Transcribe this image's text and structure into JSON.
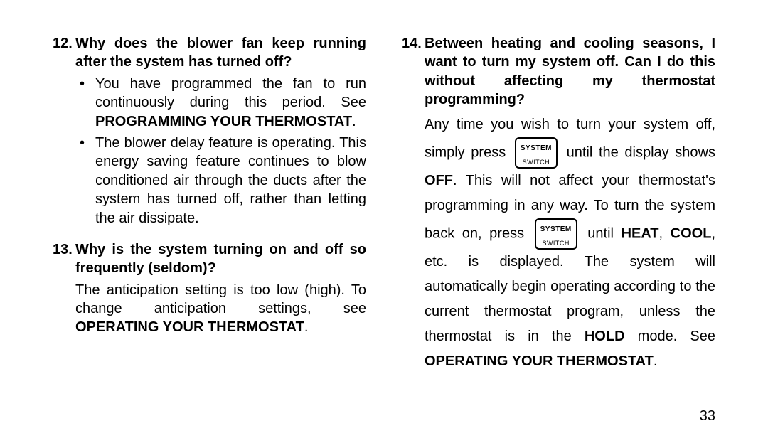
{
  "page_number": "33",
  "button": {
    "line1": "SYSTEM",
    "line2": "SWITCH"
  },
  "left": {
    "q12": {
      "num": "12.",
      "question": "Why does the blower fan keep running after the system has turned off?",
      "b1a": "You have programmed the fan to run continuously during this period. See ",
      "b1b": "PROGRAMMING YOUR THERMOSTAT",
      "b1c": ".",
      "b2": "The blower delay feature is operating. This energy saving feature continues to blow conditioned air through the ducts after the system has turned off, rather than letting the air dissipate."
    },
    "q13": {
      "num": "13.",
      "question": "Why is the system turning on and off so frequently (seldom)?",
      "a1": "The anticipation setting is too low (high). To change anticipation settings, see ",
      "a2": "OPERATING YOUR THERMOSTAT",
      "a3": "."
    }
  },
  "right": {
    "q14": {
      "num": "14.",
      "question": "Between heating and cooling seasons, I want to turn my system off. Can I do this without affecting my thermostat programming?",
      "p_a": "Any time you wish to turn your system off, simply press ",
      "p_b": " until the display shows ",
      "p_c": "OFF",
      "p_d": ". This will not affect your thermostat's programming in any way. To turn the system back on, press ",
      "p_e": " until ",
      "p_f": "HEAT",
      "p_g": ", ",
      "p_h": "COOL",
      "p_i": ", etc. is displayed. The system will automatically begin operating according to the current thermostat program, unless the thermostat is in the ",
      "p_j": "HOLD",
      "p_k": " mode. See ",
      "p_l": "OPERATING YOUR THERMOSTAT",
      "p_m": "."
    }
  }
}
